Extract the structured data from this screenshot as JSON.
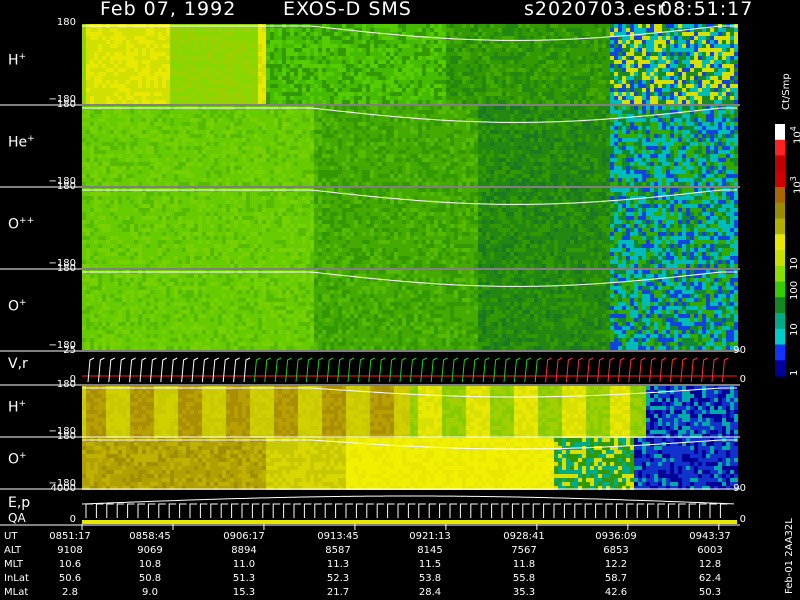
{
  "header": {
    "date": "Feb 07, 1992",
    "instrument": "EXOS-D SMS",
    "file": "s2020703.esr",
    "time": "08:51:17"
  },
  "panels": [
    {
      "label": "H",
      "sup": "+",
      "top": "180",
      "bottom": "−180",
      "scheme": "h"
    },
    {
      "label": "He",
      "sup": "+",
      "top": "180",
      "bottom": "−180",
      "scheme": "he"
    },
    {
      "label": "O",
      "sup": "++",
      "top": "180",
      "bottom": "−180",
      "scheme": "opp"
    },
    {
      "label": "O",
      "sup": "+",
      "top": "180",
      "bottom": "−180",
      "scheme": "op"
    },
    {
      "label": "V,r",
      "sup": "",
      "top": "25",
      "bottom": "0",
      "right_top": "90",
      "right_bottom": "0",
      "scheme": "vr"
    },
    {
      "label": "H",
      "sup": "+",
      "top": "180",
      "bottom": "−180",
      "scheme": "h2"
    },
    {
      "label": "O",
      "sup": "+",
      "top": "180",
      "bottom": "−180",
      "scheme": "o2"
    },
    {
      "label": "E,p",
      "label2": "QA",
      "top": "4000",
      "bottom": "0",
      "right_top": "90",
      "right_bottom": "0",
      "scheme": "ep"
    }
  ],
  "colorbar": {
    "title": "Ct/Smp",
    "labels": [
      "10",
      "10",
      "10",
      "100",
      "10",
      "1"
    ],
    "sups": [
      "4",
      "3",
      "",
      "",
      "",
      ""
    ],
    "colors": [
      "#ffffff",
      "#ff2020",
      "#c00000",
      "#d00000",
      "#aa6600",
      "#9a8a00",
      "#b0b000",
      "#e8e800",
      "#c8e000",
      "#88e000",
      "#33cc00",
      "#118822",
      "#00aa88",
      "#00cccc",
      "#1133ff",
      "#000099"
    ]
  },
  "table": {
    "rows": [
      {
        "label": "UT",
        "values": [
          "0851:17",
          "0858:45",
          "0906:17",
          "0913:45",
          "0921:13",
          "0928:41",
          "0936:09",
          "0943:37"
        ]
      },
      {
        "label": "ALT",
        "values": [
          "9108",
          "9069",
          "8894",
          "8587",
          "8145",
          "7567",
          "6853",
          "6003"
        ]
      },
      {
        "label": "MLT",
        "values": [
          "10.6",
          "10.8",
          "11.0",
          "11.3",
          "11.5",
          "11.8",
          "12.2",
          "12.8"
        ]
      },
      {
        "label": "InLat",
        "values": [
          "50.6",
          "50.8",
          "51.3",
          "52.3",
          "53.8",
          "55.8",
          "58.7",
          "62.4"
        ]
      },
      {
        "label": "MLat",
        "values": [
          "2.8",
          "9.0",
          "15.3",
          "21.7",
          "28.4",
          "35.3",
          "42.6",
          "50.3"
        ]
      }
    ]
  },
  "footer_vertical": "Feb-01 2AA32L",
  "chart_data": {
    "type": "heatmap",
    "title": "Feb 07, 1992   EXOS-D SMS",
    "x": [
      "0851:17",
      "0858:45",
      "0906:17",
      "0913:45",
      "0921:13",
      "0928:41",
      "0936:09",
      "0943:37"
    ],
    "xlabel": "UT",
    "colorbar_label": "Ct/Smp",
    "colorbar_ticks": [
      "1",
      "10",
      "100",
      "10^3",
      "10^4"
    ],
    "series": [
      {
        "name": "H+",
        "ylim": [
          -180,
          180
        ]
      },
      {
        "name": "He+",
        "ylim": [
          -180,
          180
        ]
      },
      {
        "name": "O++",
        "ylim": [
          -180,
          180
        ]
      },
      {
        "name": "O+",
        "ylim": [
          -180,
          180
        ]
      },
      {
        "name": "V,r",
        "ylim": [
          0,
          25
        ]
      },
      {
        "name": "H+",
        "ylim": [
          -180,
          180
        ]
      },
      {
        "name": "O+",
        "ylim": [
          -180,
          180
        ]
      },
      {
        "name": "E,p",
        "ylim": [
          0,
          4000
        ]
      }
    ]
  }
}
